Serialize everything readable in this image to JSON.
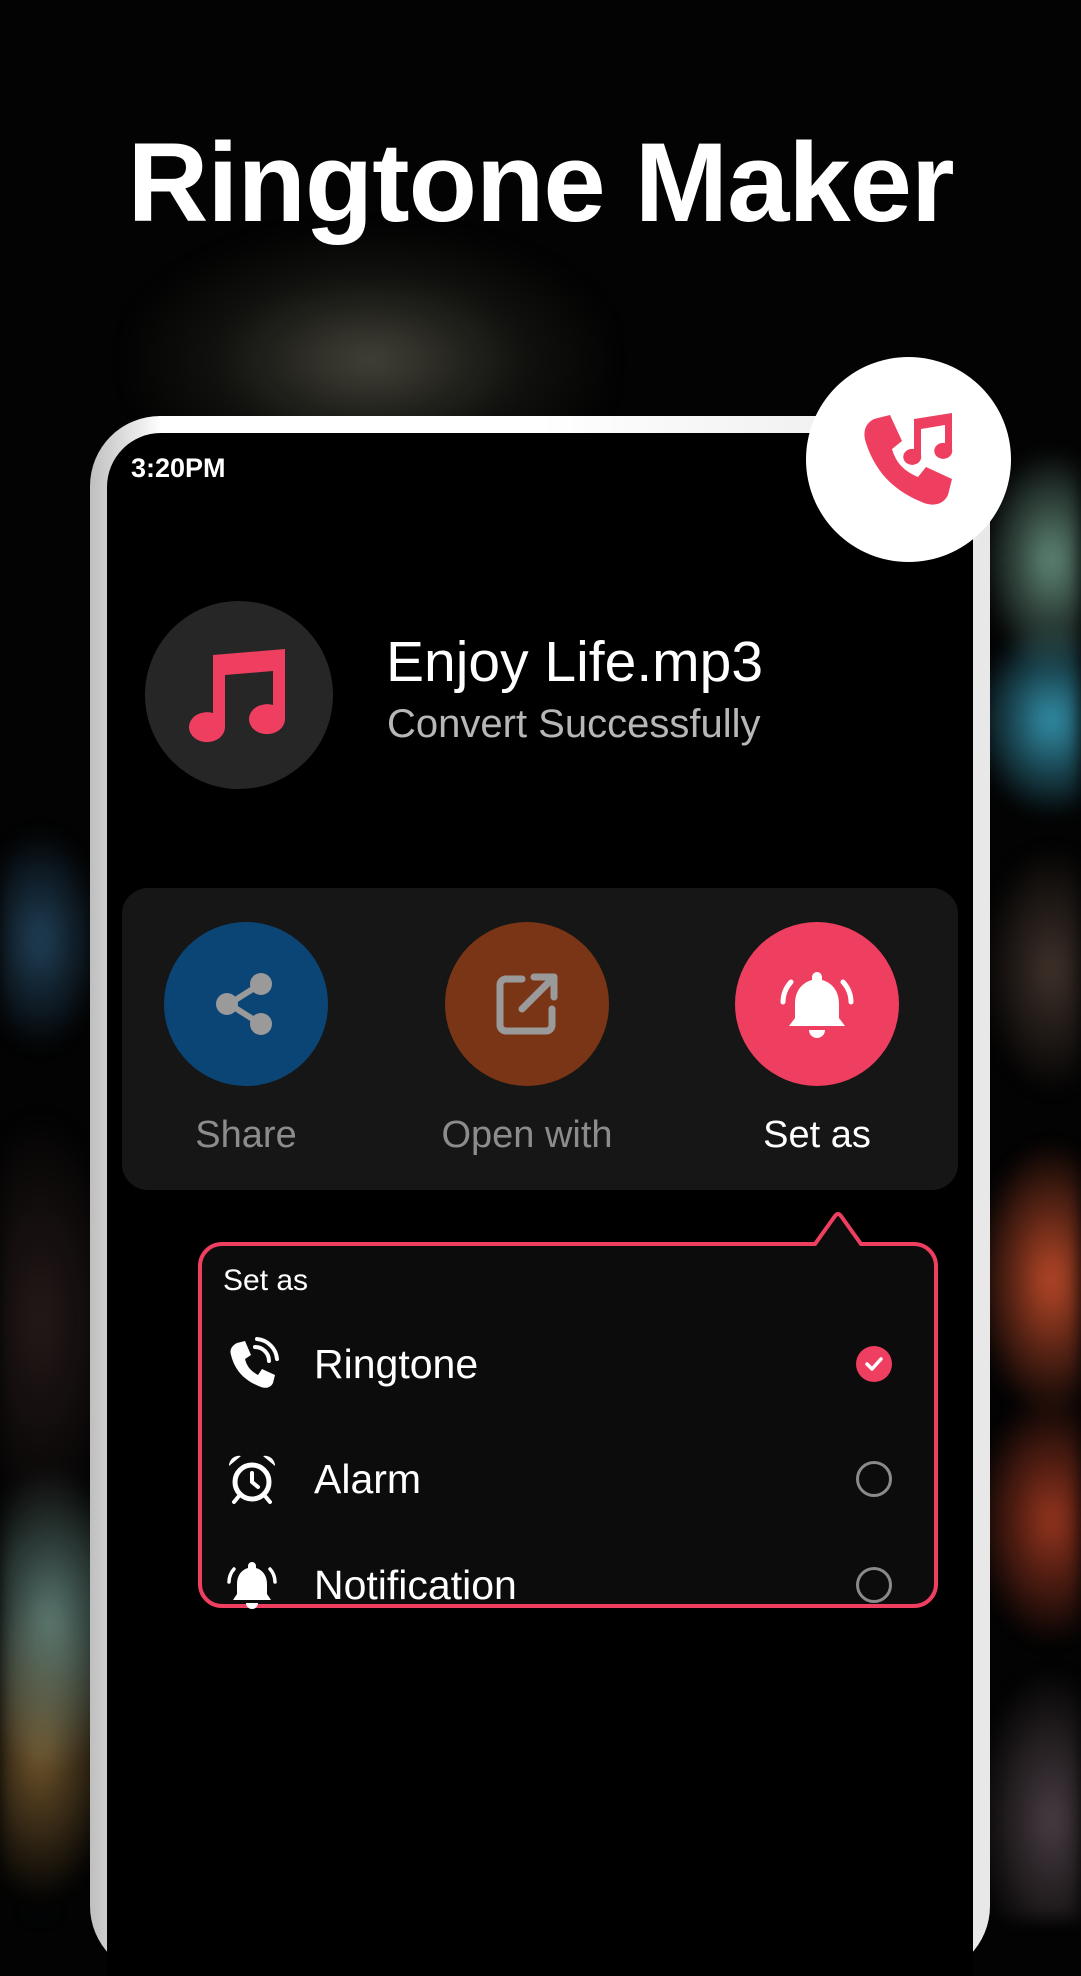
{
  "promo": {
    "title": "Ringtone Maker"
  },
  "status_bar": {
    "time": "3:20PM"
  },
  "badge": {
    "icon": "phone-music-icon"
  },
  "track": {
    "name": "Enjoy Life.mp3",
    "status": "Convert Successfully",
    "icon": "music-note-icon"
  },
  "actions": [
    {
      "label": "Share",
      "icon": "share-icon",
      "color": "#0b4576"
    },
    {
      "label": "Open with",
      "icon": "open-external-icon",
      "color": "#7a3516"
    },
    {
      "label": "Set as",
      "icon": "bell-ring-icon",
      "color": "#ef3f61"
    }
  ],
  "set_as_popup": {
    "title": "Set as",
    "options": [
      {
        "label": "Ringtone",
        "icon": "phone-ring-icon",
        "selected": true
      },
      {
        "label": "Alarm",
        "icon": "alarm-clock-icon",
        "selected": false
      },
      {
        "label": "Notification",
        "icon": "bell-icon",
        "selected": false
      }
    ]
  },
  "colors": {
    "accent": "#ef3f61",
    "background": "#000000",
    "card": "#161616"
  }
}
